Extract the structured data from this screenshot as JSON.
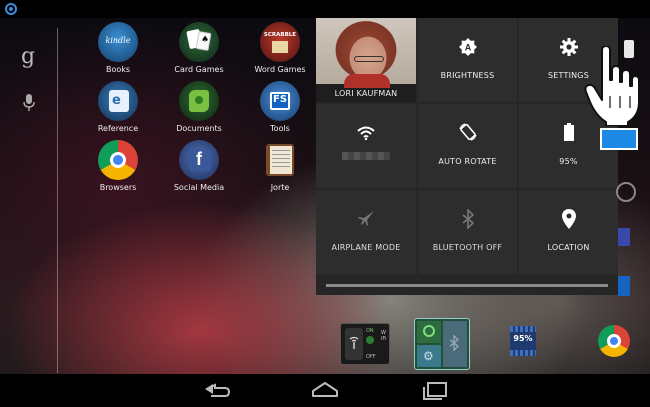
{
  "apps": [
    {
      "label": "Books",
      "icon": "kindle-books-icon",
      "badge": "kindle"
    },
    {
      "label": "Card Games",
      "icon": "card-games-icon"
    },
    {
      "label": "Word Games",
      "icon": "word-games-icon",
      "badge": "SCRABBLE"
    },
    {
      "label": "Reference",
      "icon": "reference-icon"
    },
    {
      "label": "Documents",
      "icon": "evernote-documents-icon"
    },
    {
      "label": "Tools",
      "icon": "tools-icon"
    },
    {
      "label": "Browsers",
      "icon": "chrome-browsers-icon"
    },
    {
      "label": "Social Media",
      "icon": "facebook-social-media-icon"
    },
    {
      "label": "Jorte",
      "icon": "jorte-calendar-icon"
    }
  ],
  "quick_settings": {
    "user": {
      "label": "LORI KAUFMAN"
    },
    "brightness": {
      "label": "BRIGHTNESS",
      "icon": "auto-brightness-icon"
    },
    "settings": {
      "label": "SETTINGS",
      "icon": "gear-icon"
    },
    "wifi": {
      "icon": "wifi-icon"
    },
    "auto_rotate": {
      "label": "AUTO ROTATE",
      "icon": "rotate-icon"
    },
    "battery": {
      "label": "95%",
      "icon": "battery-icon",
      "level": 0.95
    },
    "airplane": {
      "label": "AIRPLANE MODE",
      "icon": "airplane-icon"
    },
    "bluetooth": {
      "label": "BLUETOOTH OFF",
      "icon": "bluetooth-icon"
    },
    "location": {
      "label": "LOCATION",
      "icon": "location-pin-icon"
    }
  },
  "dock": {
    "wifi_toggle": {
      "on": "ON",
      "off": "OFF",
      "side": "WiFi"
    },
    "battery_widget": {
      "value": "95%"
    }
  },
  "colors": {
    "accent_blue": "#33b5e5",
    "panel_bg": "#262626",
    "tile_bg": "#2d2d2d"
  }
}
